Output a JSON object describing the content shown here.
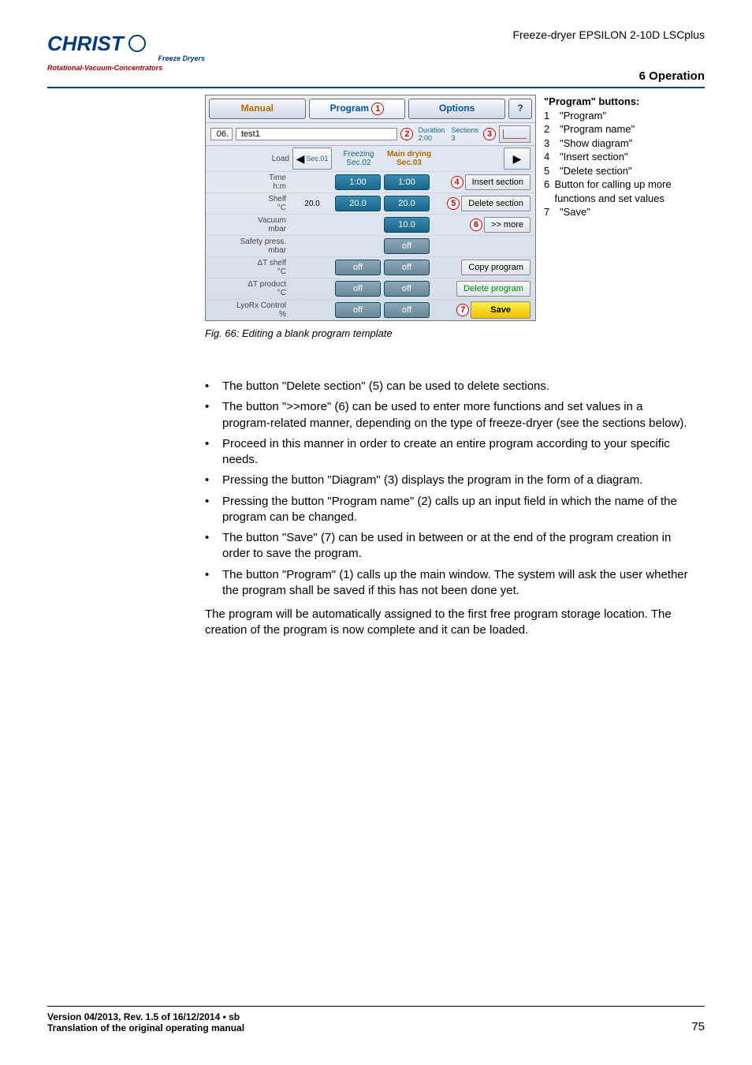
{
  "header": {
    "doc_title": "Freeze-dryer EPSILON 2-10D LSCplus",
    "section": "6 Operation"
  },
  "logo": {
    "brand": "CHRIST",
    "sub1": "Freeze Dryers",
    "sub2": "Rotational-Vacuum-Concentrators"
  },
  "screenshot": {
    "tabs": {
      "manual": "Manual",
      "program": "Program",
      "options": "Options",
      "help": "?"
    },
    "circles": {
      "c1": "1",
      "c2": "2",
      "c3": "3",
      "c4": "4",
      "c5": "5",
      "c6": "6",
      "c7": "7"
    },
    "program_row": {
      "num": "06.",
      "name": "test1",
      "duration_label": "Duration",
      "duration_val": "2:00",
      "sections_label": "Sections",
      "sections_val": "3"
    },
    "section_head": {
      "load": "Load",
      "s1": "Sec.01",
      "freezing": "Freezing",
      "s2": "Sec.02",
      "main": "Main drying",
      "s3": "Sec.03"
    },
    "rows": {
      "time": {
        "label": "Time",
        "unit": "h:m",
        "v1": "1:00",
        "v2": "1:00"
      },
      "shelf": {
        "label": "Shelf",
        "unit": "°C",
        "extra": "20.0",
        "v1": "20.0",
        "v2": "20.0"
      },
      "vac": {
        "label": "Vacuum",
        "unit": "mbar",
        "v2": "10.0"
      },
      "safety": {
        "label": "Safety press.",
        "unit": "mbar",
        "v2": "off"
      },
      "dtshelf": {
        "label": "ΔT shelf",
        "unit": "°C",
        "v1": "off",
        "v2": "off"
      },
      "dtprod": {
        "label": "ΔT product",
        "unit": "°C",
        "v1": "off",
        "v2": "off"
      },
      "lyorx": {
        "label": "LyoRx Control",
        "unit": "%",
        "v1": "off",
        "v2": "off"
      }
    },
    "actions": {
      "insert_section": "Insert section",
      "delete_section": "Delete section",
      "more": ">> more",
      "copy_program": "Copy program",
      "delete_program": "Delete program",
      "save": "Save"
    }
  },
  "legend": {
    "title": "\"Program\" buttons:",
    "items": [
      {
        "n": "1",
        "t": "\"Program\""
      },
      {
        "n": "2",
        "t": "\"Program name\""
      },
      {
        "n": "3",
        "t": "\"Show diagram\""
      },
      {
        "n": "4",
        "t": "\"Insert section\""
      },
      {
        "n": "5",
        "t": "\"Delete section\""
      },
      {
        "n": "6",
        "t": "Button for calling up more functions and set values"
      },
      {
        "n": "7",
        "t": "\"Save\""
      }
    ]
  },
  "caption": "Fig. 66: Editing a blank program template",
  "bullets": [
    "The button \"Delete section\" (5) can be used to delete sections.",
    "The button \">>more\" (6) can be used to enter more functions and set values in a program-related manner, depending on the type of freeze-dryer (see the sections below).",
    "Proceed in this manner in order to create an entire program according to your specific needs.",
    "Pressing the button \"Diagram\" (3) displays the program in the form of a diagram.",
    "Pressing the button \"Program name\" (2) calls up an input field in which the name of the program can be changed.",
    "The button \"Save\" (7) can be used in between or at the end of the program creation in order to save the program.",
    "The button \"Program\" (1) calls up the main window. The system will ask the user whether the program shall be saved if this has not been done yet."
  ],
  "para": "The program will be automatically assigned to the first free program storage location. The creation of the program is now complete and it can be loaded.",
  "footer": {
    "l1": "Version 04/2013, Rev. 1.5 of 16/12/2014 • sb",
    "l2": "Translation of the original operating manual",
    "page": "75"
  }
}
